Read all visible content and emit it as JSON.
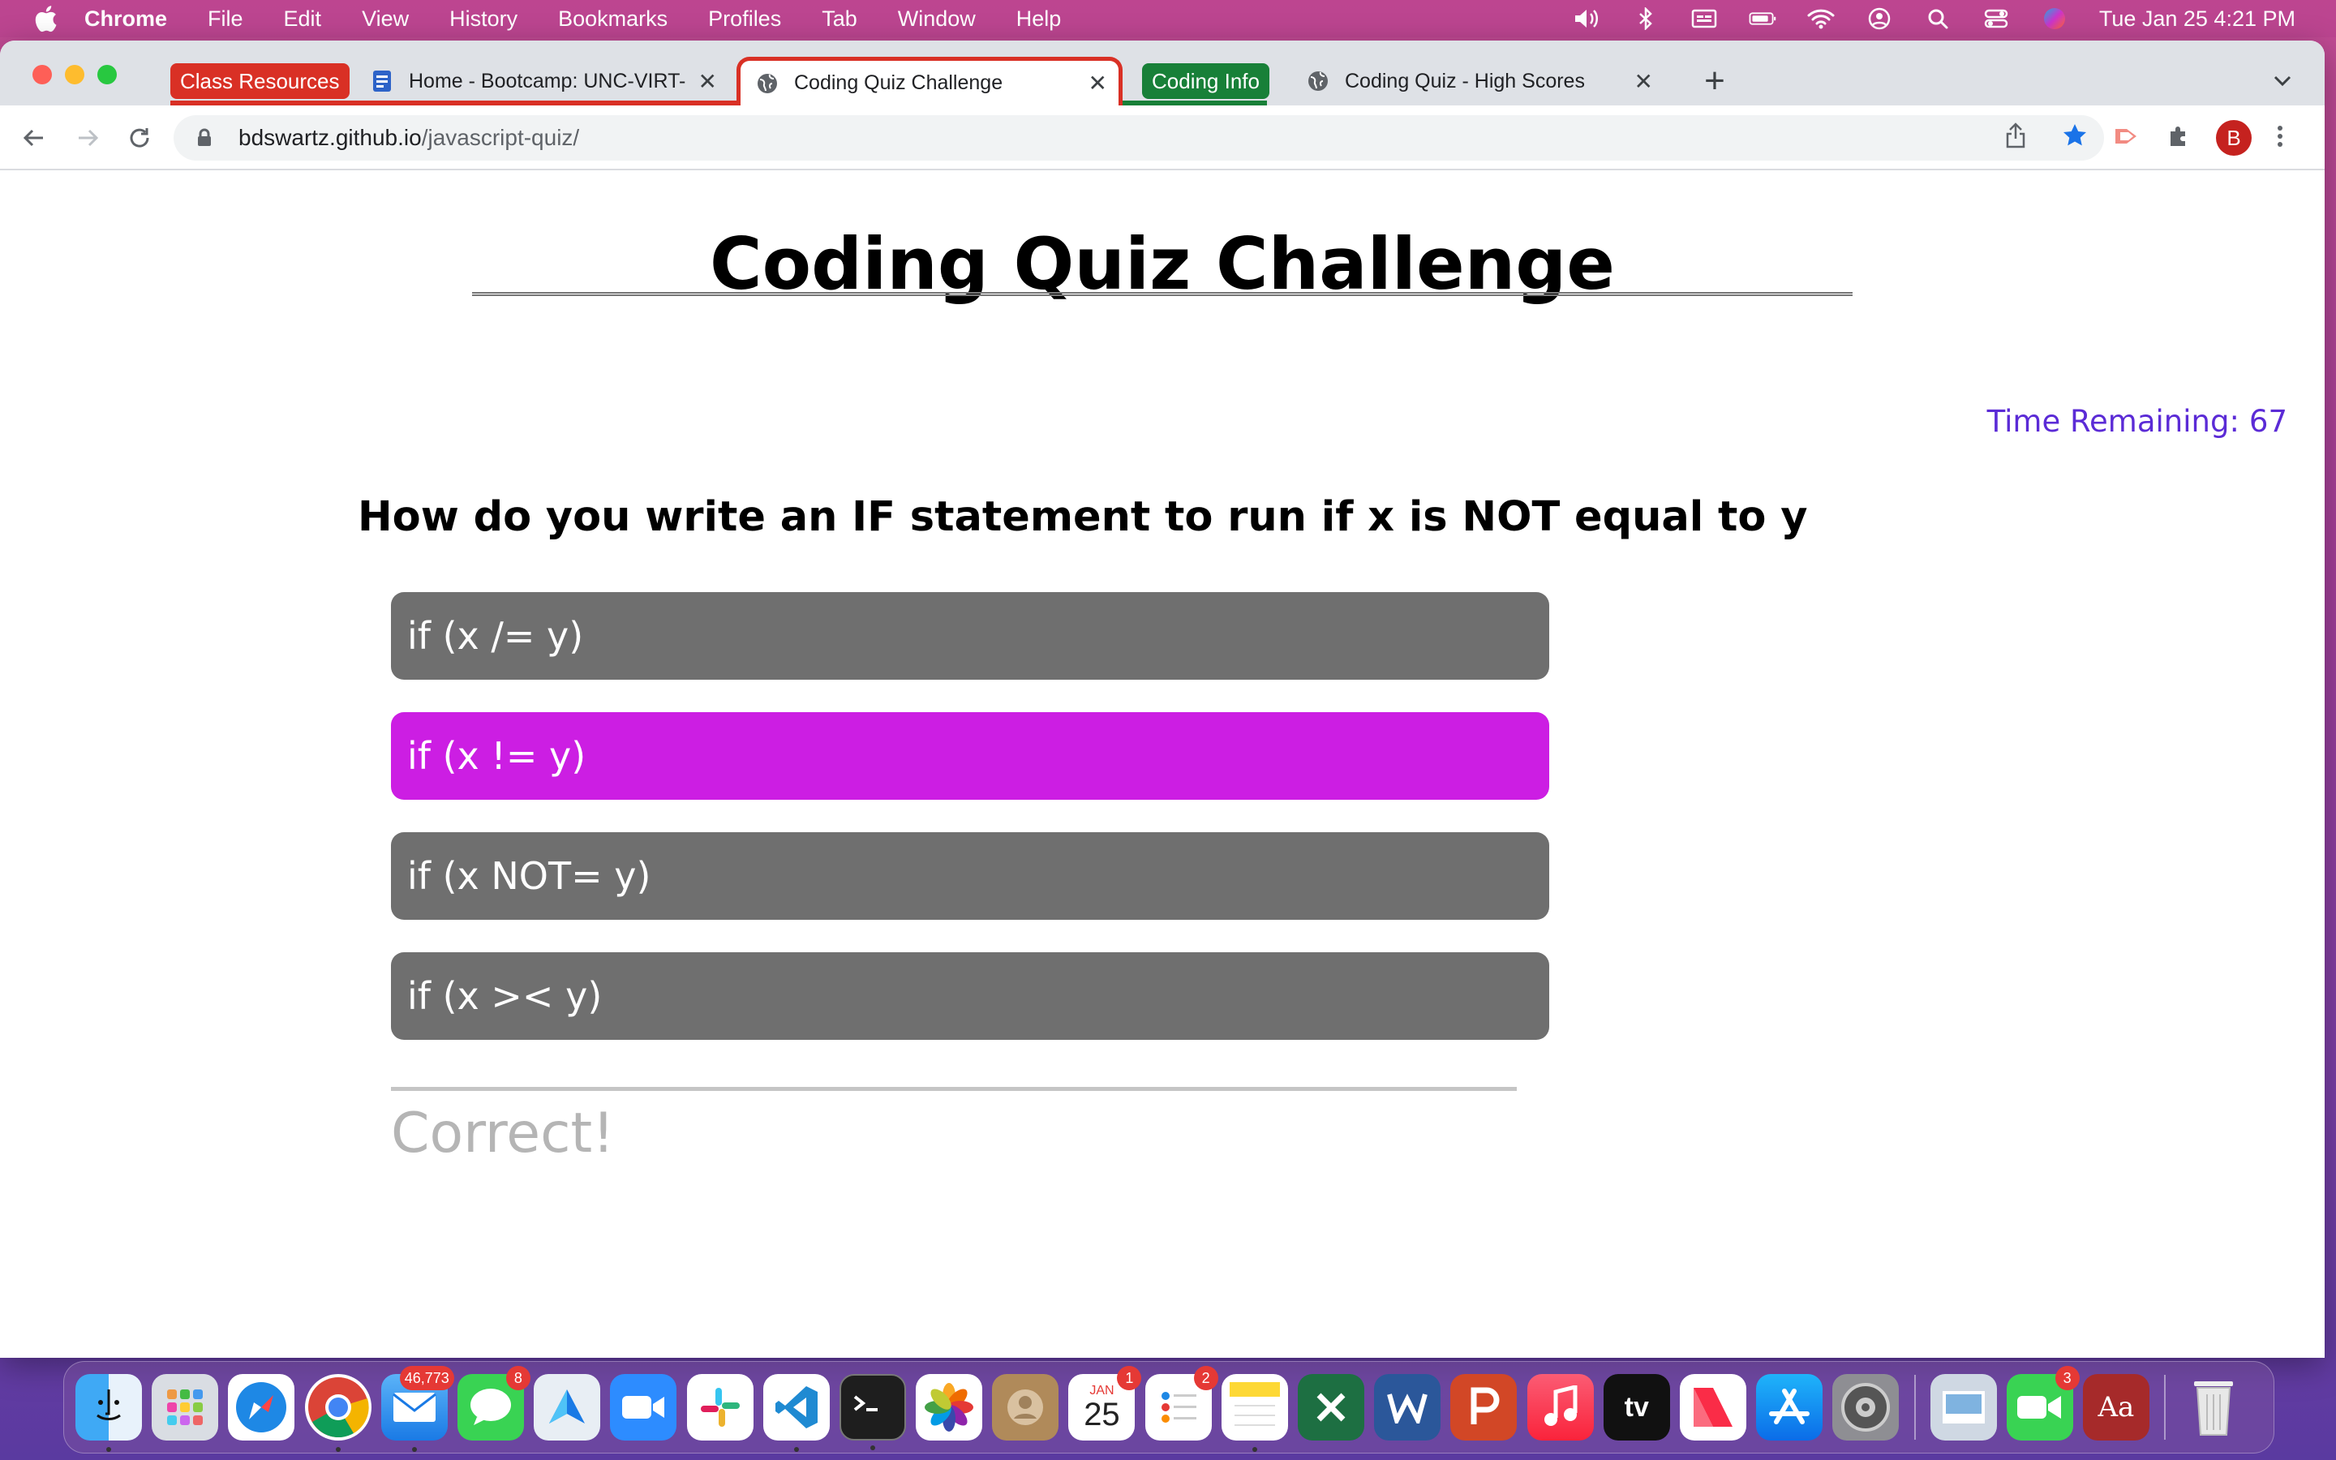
{
  "menubar": {
    "app_name": "Chrome",
    "items": [
      "File",
      "Edit",
      "View",
      "History",
      "Bookmarks",
      "Profiles",
      "Tab",
      "Window",
      "Help"
    ],
    "clock": "Tue Jan 25  4:21 PM"
  },
  "tabs": {
    "group1_label": "Class Resources",
    "group1_color": "#d93025",
    "tab1_title": "Home - Bootcamp: UNC-VIRT-",
    "tab2_title": "Coding Quiz Challenge",
    "group2_label": "Coding Info",
    "group2_color": "#188038",
    "tab3_title": "Coding Quiz - High Scores"
  },
  "omnibox": {
    "url_host": "bdswartz.github.io",
    "url_path": "/javascript-quiz/"
  },
  "profile": {
    "initial": "B"
  },
  "page": {
    "title": "Coding Quiz Challenge",
    "timer_label": "Time Remaining:",
    "timer_value": "67",
    "question": "How do you write an IF statement to run if x is NOT equal to y",
    "answers": [
      "if (x /= y)",
      "if (x != y)",
      "if (x NOT= y)",
      "if (x >< y)"
    ],
    "selected_answer_index": 1,
    "feedback": "Correct!"
  },
  "colors": {
    "selected_answer": "#cc1ee3",
    "answer_default": "#6f6f6f",
    "timer": "#5b2bd6"
  },
  "dock": {
    "mail_badge": "46,773",
    "messages_badge": "8",
    "calendar_month": "JAN",
    "calendar_day": "25",
    "calendar_badge": "1",
    "reminders_badge": "2",
    "tv_label": "tv",
    "facetime_badge": "3",
    "dictionary_label": "Aa"
  }
}
